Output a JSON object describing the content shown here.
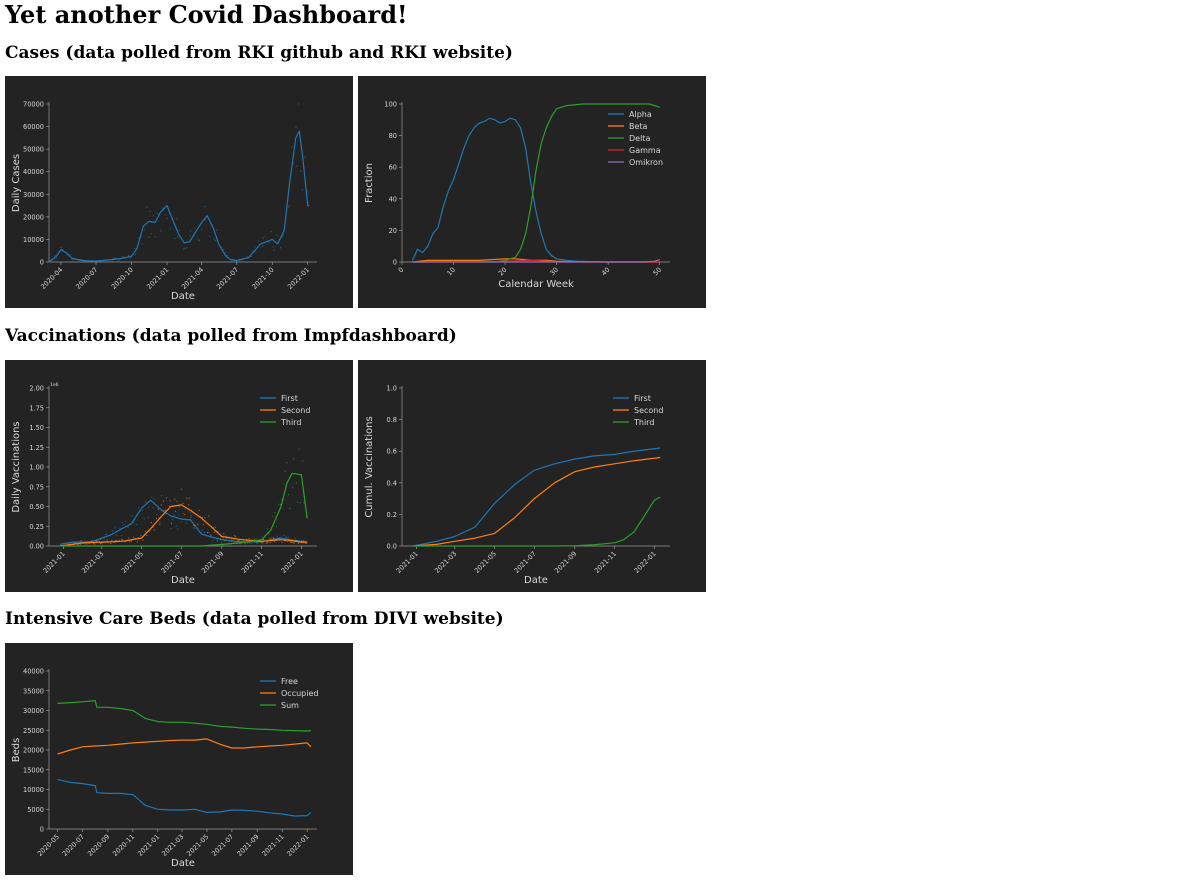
{
  "page": {
    "title": "Yet another Covid Dashboard!",
    "sections": [
      "Cases (data polled from RKI github and RKI website)",
      "Vaccinations (data polled from Impfdashboard)",
      "Intensive Care Beds (data polled from DIVI website)"
    ]
  },
  "colors": {
    "panel_bg": "#232323",
    "axis": "#9a9a9a",
    "text": "#d8d8d8",
    "blue": "#1f77b4",
    "orange": "#ff7f0e",
    "green": "#2ca02c",
    "red": "#d62728",
    "purple": "#9467bd"
  },
  "chart_data": [
    {
      "id": "daily-cases",
      "type": "line",
      "xtype": "date",
      "xlim": [
        "2020-03-01",
        "2022-01-25"
      ],
      "ylim": [
        0,
        70000
      ],
      "yticks": [
        0,
        10000,
        20000,
        30000,
        40000,
        50000,
        60000,
        70000
      ],
      "xticks": [
        "2020-04",
        "2020-07",
        "2020-10",
        "2021-01",
        "2021-04",
        "2021-07",
        "2021-10",
        "2022-01"
      ],
      "xlabel": "Date",
      "ylabel": "Daily Cases",
      "scatter_overlay": true,
      "series": [
        {
          "color": "#1f77b4",
          "x": [
            "2020-03-01",
            "2020-03-20",
            "2020-04-01",
            "2020-04-15",
            "2020-05-01",
            "2020-06-01",
            "2020-07-01",
            "2020-08-01",
            "2020-09-01",
            "2020-10-01",
            "2020-10-15",
            "2020-11-01",
            "2020-11-15",
            "2020-12-01",
            "2020-12-15",
            "2021-01-01",
            "2021-01-15",
            "2021-02-01",
            "2021-02-15",
            "2021-03-01",
            "2021-03-15",
            "2021-04-01",
            "2021-04-15",
            "2021-05-01",
            "2021-05-15",
            "2021-06-01",
            "2021-06-15",
            "2021-07-01",
            "2021-08-01",
            "2021-09-01",
            "2021-10-01",
            "2021-10-15",
            "2021-11-01",
            "2021-11-15",
            "2021-12-01",
            "2021-12-10",
            "2021-12-20",
            "2022-01-01",
            "2022-01-05"
          ],
          "values": [
            0,
            2500,
            5500,
            4000,
            1500,
            600,
            400,
            900,
            1500,
            2500,
            6000,
            16000,
            18000,
            17500,
            22000,
            25000,
            19000,
            12000,
            8500,
            9000,
            13000,
            17500,
            20500,
            15000,
            8000,
            3000,
            1000,
            600,
            2000,
            8000,
            10000,
            8000,
            14000,
            35000,
            55000,
            58000,
            45000,
            25000,
            25000
          ]
        }
      ]
    },
    {
      "id": "variant-fraction",
      "type": "line",
      "xlim": [
        0,
        52
      ],
      "ylim": [
        0,
        100
      ],
      "xticks": [
        0,
        10,
        20,
        30,
        40,
        50
      ],
      "yticks": [
        0,
        20,
        40,
        60,
        80,
        100
      ],
      "xlabel": "Calendar Week",
      "ylabel": "Fraction",
      "legend": "top-right",
      "series": [
        {
          "name": "Alpha",
          "color": "#1f77b4",
          "x": [
            2,
            3,
            4,
            5,
            6,
            7,
            8,
            9,
            10,
            11,
            12,
            13,
            14,
            15,
            16,
            17,
            18,
            19,
            20,
            21,
            22,
            23,
            24,
            25,
            26,
            27,
            28,
            29,
            30,
            32,
            34,
            40,
            50
          ],
          "values": [
            1,
            8,
            6,
            10,
            18,
            22,
            35,
            45,
            52,
            62,
            72,
            80,
            85,
            88,
            89,
            91,
            90,
            88,
            89,
            91,
            90,
            85,
            72,
            50,
            32,
            18,
            8,
            4,
            2,
            1,
            0.5,
            0,
            0
          ]
        },
        {
          "name": "Beta",
          "color": "#ff7f0e",
          "x": [
            2,
            5,
            10,
            15,
            20,
            22,
            25,
            28,
            30,
            35,
            40,
            50
          ],
          "values": [
            0,
            1,
            1,
            1,
            2,
            2,
            1,
            1,
            0.5,
            0,
            0,
            0
          ]
        },
        {
          "name": "Delta",
          "color": "#2ca02c",
          "x": [
            2,
            10,
            15,
            18,
            20,
            21,
            22,
            23,
            24,
            25,
            26,
            27,
            28,
            29,
            30,
            32,
            35,
            40,
            45,
            48,
            50
          ],
          "values": [
            0,
            0,
            0,
            0,
            1,
            2,
            3,
            8,
            18,
            35,
            58,
            75,
            85,
            92,
            97,
            99,
            100,
            100,
            100,
            100,
            98
          ]
        },
        {
          "name": "Gamma",
          "color": "#d62728",
          "x": [
            2,
            15,
            20,
            25,
            28,
            30,
            40,
            50
          ],
          "values": [
            0,
            0,
            0.5,
            1,
            0.5,
            0,
            0,
            0
          ]
        },
        {
          "name": "Omikron",
          "color": "#9467bd",
          "x": [
            2,
            40,
            47,
            49,
            50
          ],
          "values": [
            0,
            0,
            0,
            0.5,
            1.5
          ]
        }
      ]
    },
    {
      "id": "daily-vaccinations",
      "type": "line",
      "xtype": "date",
      "xlim": [
        "2020-12-10",
        "2022-01-25"
      ],
      "ylim": [
        0,
        2.0
      ],
      "yscale_note": "1e6",
      "yticks": [
        0.0,
        0.25,
        0.5,
        0.75,
        1.0,
        1.25,
        1.5,
        1.75,
        2.0
      ],
      "xticks": [
        "2021-01",
        "2021-03",
        "2021-05",
        "2021-07",
        "2021-09",
        "2021-11",
        "2022-01"
      ],
      "xlabel": "Date",
      "ylabel": "Daily Vaccinations",
      "legend": "top-right",
      "scatter_overlay": true,
      "series": [
        {
          "name": "First",
          "color": "#1f77b4",
          "x": [
            "2020-12-27",
            "2021-01-15",
            "2021-02-01",
            "2021-02-15",
            "2021-03-01",
            "2021-03-15",
            "2021-04-01",
            "2021-04-15",
            "2021-05-01",
            "2021-05-15",
            "2021-06-01",
            "2021-06-15",
            "2021-07-01",
            "2021-07-15",
            "2021-08-01",
            "2021-09-01",
            "2021-10-01",
            "2021-11-01",
            "2021-12-01",
            "2021-12-15",
            "2022-01-01",
            "2022-01-10"
          ],
          "values": [
            0.02,
            0.05,
            0.05,
            0.06,
            0.1,
            0.14,
            0.22,
            0.28,
            0.48,
            0.58,
            0.45,
            0.38,
            0.34,
            0.33,
            0.15,
            0.08,
            0.05,
            0.06,
            0.1,
            0.08,
            0.06,
            0.04
          ]
        },
        {
          "name": "Second",
          "color": "#ff7f0e",
          "x": [
            "2020-12-27",
            "2021-01-15",
            "2021-02-01",
            "2021-03-01",
            "2021-04-01",
            "2021-05-01",
            "2021-05-15",
            "2021-06-01",
            "2021-06-15",
            "2021-07-01",
            "2021-07-15",
            "2021-08-01",
            "2021-08-15",
            "2021-09-01",
            "2021-10-01",
            "2021-11-01",
            "2021-12-01",
            "2021-12-15",
            "2022-01-01",
            "2022-01-10"
          ],
          "values": [
            0,
            0.02,
            0.04,
            0.05,
            0.06,
            0.1,
            0.22,
            0.38,
            0.5,
            0.52,
            0.45,
            0.35,
            0.25,
            0.12,
            0.08,
            0.06,
            0.08,
            0.07,
            0.05,
            0.05
          ]
        },
        {
          "name": "Third",
          "color": "#2ca02c",
          "x": [
            "2020-12-27",
            "2021-08-01",
            "2021-09-01",
            "2021-10-01",
            "2021-11-01",
            "2021-11-15",
            "2021-12-01",
            "2021-12-10",
            "2021-12-18",
            "2022-01-01",
            "2022-01-10"
          ],
          "values": [
            0,
            0,
            0.02,
            0.04,
            0.08,
            0.2,
            0.5,
            0.8,
            0.92,
            0.9,
            0.35
          ]
        }
      ]
    },
    {
      "id": "cumulative-vaccinations",
      "type": "line",
      "xtype": "date",
      "xlim": [
        "2020-12-10",
        "2022-01-25"
      ],
      "ylim": [
        0,
        1.0
      ],
      "yticks": [
        0.0,
        0.2,
        0.4,
        0.6,
        0.8,
        1.0
      ],
      "xticks": [
        "2021-01",
        "2021-03",
        "2021-05",
        "2021-07",
        "2021-09",
        "2021-11",
        "2022-01"
      ],
      "xlabel": "Date",
      "ylabel": "Cumul. Vaccinations",
      "legend": "top-right",
      "series": [
        {
          "name": "First",
          "color": "#1f77b4",
          "x": [
            "2020-12-27",
            "2021-02-01",
            "2021-03-01",
            "2021-04-01",
            "2021-05-01",
            "2021-06-01",
            "2021-07-01",
            "2021-08-01",
            "2021-09-01",
            "2021-10-01",
            "2021-11-01",
            "2021-12-01",
            "2022-01-10"
          ],
          "values": [
            0,
            0.03,
            0.06,
            0.12,
            0.27,
            0.39,
            0.48,
            0.52,
            0.55,
            0.57,
            0.58,
            0.6,
            0.62
          ]
        },
        {
          "name": "Second",
          "color": "#ff7f0e",
          "x": [
            "2020-12-27",
            "2021-02-01",
            "2021-03-01",
            "2021-04-01",
            "2021-05-01",
            "2021-06-01",
            "2021-07-01",
            "2021-08-01",
            "2021-09-01",
            "2021-10-01",
            "2021-11-01",
            "2021-12-01",
            "2022-01-10"
          ],
          "values": [
            0,
            0.01,
            0.03,
            0.05,
            0.08,
            0.18,
            0.3,
            0.4,
            0.47,
            0.5,
            0.52,
            0.54,
            0.56
          ]
        },
        {
          "name": "Third",
          "color": "#2ca02c",
          "x": [
            "2020-12-27",
            "2021-08-01",
            "2021-09-01",
            "2021-10-01",
            "2021-11-01",
            "2021-11-15",
            "2021-12-01",
            "2021-12-15",
            "2022-01-01",
            "2022-01-10"
          ],
          "values": [
            0,
            0,
            0.002,
            0.008,
            0.02,
            0.04,
            0.09,
            0.18,
            0.29,
            0.31
          ]
        }
      ]
    },
    {
      "id": "icu-beds",
      "type": "line",
      "xtype": "date",
      "xlim": [
        "2020-04-10",
        "2022-01-25"
      ],
      "ylim": [
        0,
        40000
      ],
      "yticks": [
        0,
        5000,
        10000,
        15000,
        20000,
        25000,
        30000,
        35000,
        40000
      ],
      "xticks": [
        "2020-05",
        "2020-07",
        "2020-09",
        "2020-11",
        "2021-01",
        "2021-03",
        "2021-05",
        "2021-07",
        "2021-09",
        "2021-11",
        "2022-01"
      ],
      "xlabel": "Date",
      "ylabel": "Beds",
      "legend": "top-right",
      "series": [
        {
          "name": "Free",
          "color": "#1f77b4",
          "x": [
            "2020-05-01",
            "2020-06-01",
            "2020-07-01",
            "2020-08-01",
            "2020-08-05",
            "2020-09-01",
            "2020-10-01",
            "2020-11-01",
            "2020-12-01",
            "2021-01-01",
            "2021-02-01",
            "2021-03-01",
            "2021-04-01",
            "2021-05-01",
            "2021-06-01",
            "2021-07-01",
            "2021-08-01",
            "2021-09-01",
            "2021-10-01",
            "2021-11-01",
            "2021-12-01",
            "2022-01-01",
            "2022-01-10"
          ],
          "values": [
            12500,
            11800,
            11500,
            11000,
            9200,
            9000,
            9000,
            8700,
            6000,
            5000,
            4800,
            4800,
            5000,
            4200,
            4300,
            4800,
            4700,
            4500,
            4100,
            3800,
            3300,
            3400,
            4200
          ]
        },
        {
          "name": "Occupied",
          "color": "#ff7f0e",
          "x": [
            "2020-05-01",
            "2020-06-01",
            "2020-07-01",
            "2020-08-01",
            "2020-09-01",
            "2020-10-01",
            "2020-11-01",
            "2020-12-01",
            "2021-01-01",
            "2021-02-01",
            "2021-03-01",
            "2021-04-01",
            "2021-05-01",
            "2021-06-01",
            "2021-07-01",
            "2021-08-01",
            "2021-09-01",
            "2021-10-01",
            "2021-11-01",
            "2021-12-01",
            "2022-01-01",
            "2022-01-10"
          ],
          "values": [
            19000,
            20000,
            20800,
            21000,
            21200,
            21500,
            21800,
            22000,
            22200,
            22400,
            22500,
            22500,
            22800,
            21500,
            20500,
            20500,
            20800,
            21000,
            21200,
            21500,
            21800,
            20800
          ]
        },
        {
          "name": "Sum",
          "color": "#2ca02c",
          "x": [
            "2020-05-01",
            "2020-06-01",
            "2020-07-01",
            "2020-08-01",
            "2020-08-05",
            "2020-09-01",
            "2020-10-01",
            "2020-11-01",
            "2020-12-01",
            "2021-01-01",
            "2021-02-01",
            "2021-03-01",
            "2021-04-01",
            "2021-05-01",
            "2021-06-01",
            "2021-07-01",
            "2021-08-01",
            "2021-09-01",
            "2021-10-01",
            "2021-11-01",
            "2021-12-01",
            "2022-01-01",
            "2022-01-10"
          ],
          "values": [
            31800,
            32000,
            32200,
            32500,
            30800,
            30800,
            30500,
            30000,
            28000,
            27200,
            27000,
            27000,
            26800,
            26500,
            26000,
            25800,
            25500,
            25300,
            25200,
            25000,
            24900,
            24800,
            24900
          ]
        }
      ]
    }
  ]
}
